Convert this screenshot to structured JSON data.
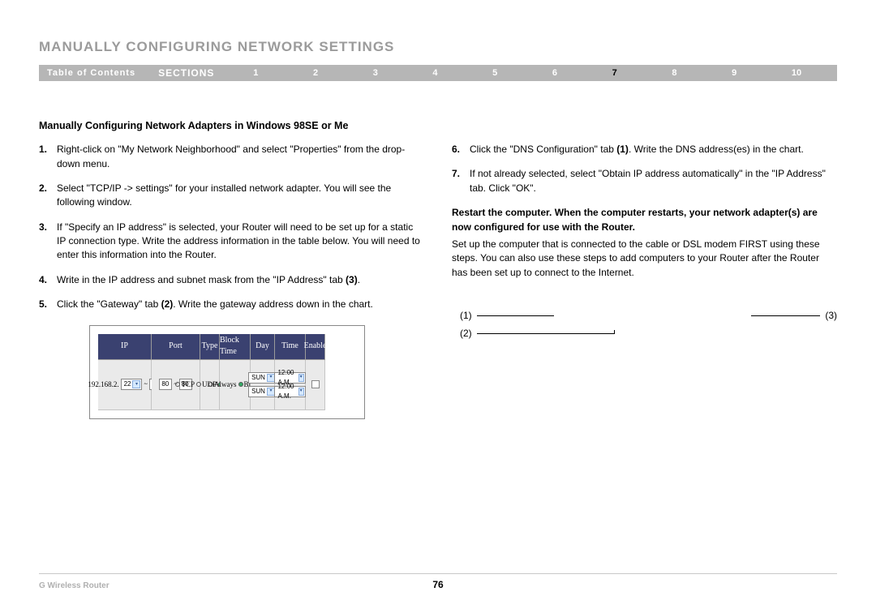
{
  "page_title": "MANUALLY CONFIGURING NETWORK SETTINGS",
  "nav": {
    "toc": "Table of Contents",
    "sections_label": "SECTIONS",
    "numbers": [
      "1",
      "2",
      "3",
      "4",
      "5",
      "6",
      "7",
      "8",
      "9",
      "10"
    ],
    "active_index": 6
  },
  "subheading": "Manually Configuring Network Adapters in Windows 98SE or Me",
  "left_steps": [
    {
      "num": "1.",
      "text": "Right-click on \"My Network Neighborhood\" and select \"Properties\" from the drop-down menu."
    },
    {
      "num": "2.",
      "text": "Select \"TCP/IP -> settings\" for your installed network adapter. You will see the following window."
    },
    {
      "num": "3.",
      "text": "If \"Specify an IP address\" is selected, your Router will need to be set up for a static IP connection type. Write the address information in the table below. You will need to enter this information into the Router."
    },
    {
      "num": "4.",
      "text": "Write in the IP address and subnet mask from the \"IP Address\" tab ",
      "trail_bold": "(3)",
      "suffix": "."
    },
    {
      "num": "5.",
      "text": "Click the \"Gateway\" tab ",
      "trail_bold": "(2)",
      "suffix": ". Write the gateway address down in the chart."
    }
  ],
  "right_steps": [
    {
      "num": "6.",
      "text": "Click the \"DNS Configuration\" tab ",
      "trail_bold": "(1)",
      "suffix": ". Write the DNS address(es) in the chart."
    },
    {
      "num": "7.",
      "text": "If not already selected, select \"Obtain IP address automatically\" in the \"IP Address\" tab. Click \"OK\"."
    }
  ],
  "restart_bold": "Restart the computer. When the computer restarts, your network adapter(s) are now configured for use with the Router.",
  "restart_para": "Set up the computer that is connected to the cable or DSL modem FIRST using these steps. You can also use these steps to add computers to your Router after the Router has been set up to connect to the Internet.",
  "callouts": {
    "c1": "(1)",
    "c2": "(2)",
    "c3": "(3)"
  },
  "table": {
    "headers": [
      "IP",
      "Port",
      "Type",
      "Block Time",
      "Day",
      "Time",
      "Enable"
    ],
    "row": {
      "ip_prefix": "192.168.2.",
      "ip_input": "22",
      "port_from": "80",
      "port_to": "80",
      "types": [
        "TCP",
        "UDP",
        "BOTH"
      ],
      "type_selected": "BOTH",
      "block_times": [
        "Always",
        "Block"
      ],
      "block_selected": "Block",
      "day": "SUN",
      "time": "12:00 A.M.",
      "enable": false
    }
  },
  "footer": {
    "product": "G Wireless Router",
    "page_number": "76"
  }
}
